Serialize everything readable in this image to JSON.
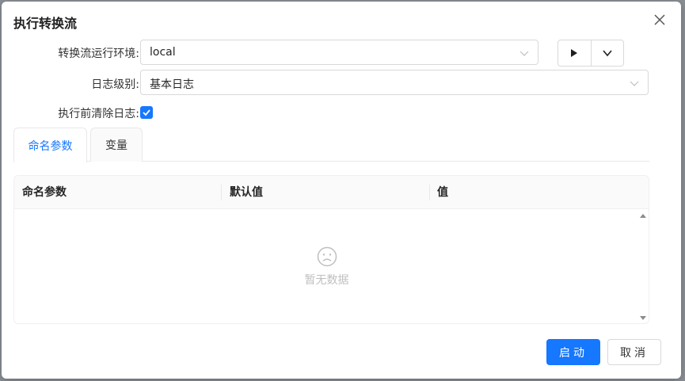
{
  "dialog": {
    "title": "执行转换流"
  },
  "form": {
    "env_label": "转换流运行环境:",
    "env_value": "local",
    "log_level_label": "日志级别:",
    "log_level_value": "基本日志",
    "clear_log_label": "执行前清除日志:",
    "clear_log_checked": true
  },
  "tabs": [
    {
      "label": "命名参数",
      "active": true
    },
    {
      "label": "变量",
      "active": false
    }
  ],
  "table": {
    "columns": [
      "命名参数",
      "默认值",
      "值"
    ],
    "rows": [],
    "empty_text": "暂无数据"
  },
  "footer": {
    "start_label": "启动",
    "cancel_label": "取消"
  },
  "colors": {
    "primary": "#1677ff",
    "border": "#d9d9d9"
  },
  "icons": [
    "close-icon",
    "play-icon",
    "chevron-down-icon",
    "check-icon",
    "sad-face-icon"
  ]
}
